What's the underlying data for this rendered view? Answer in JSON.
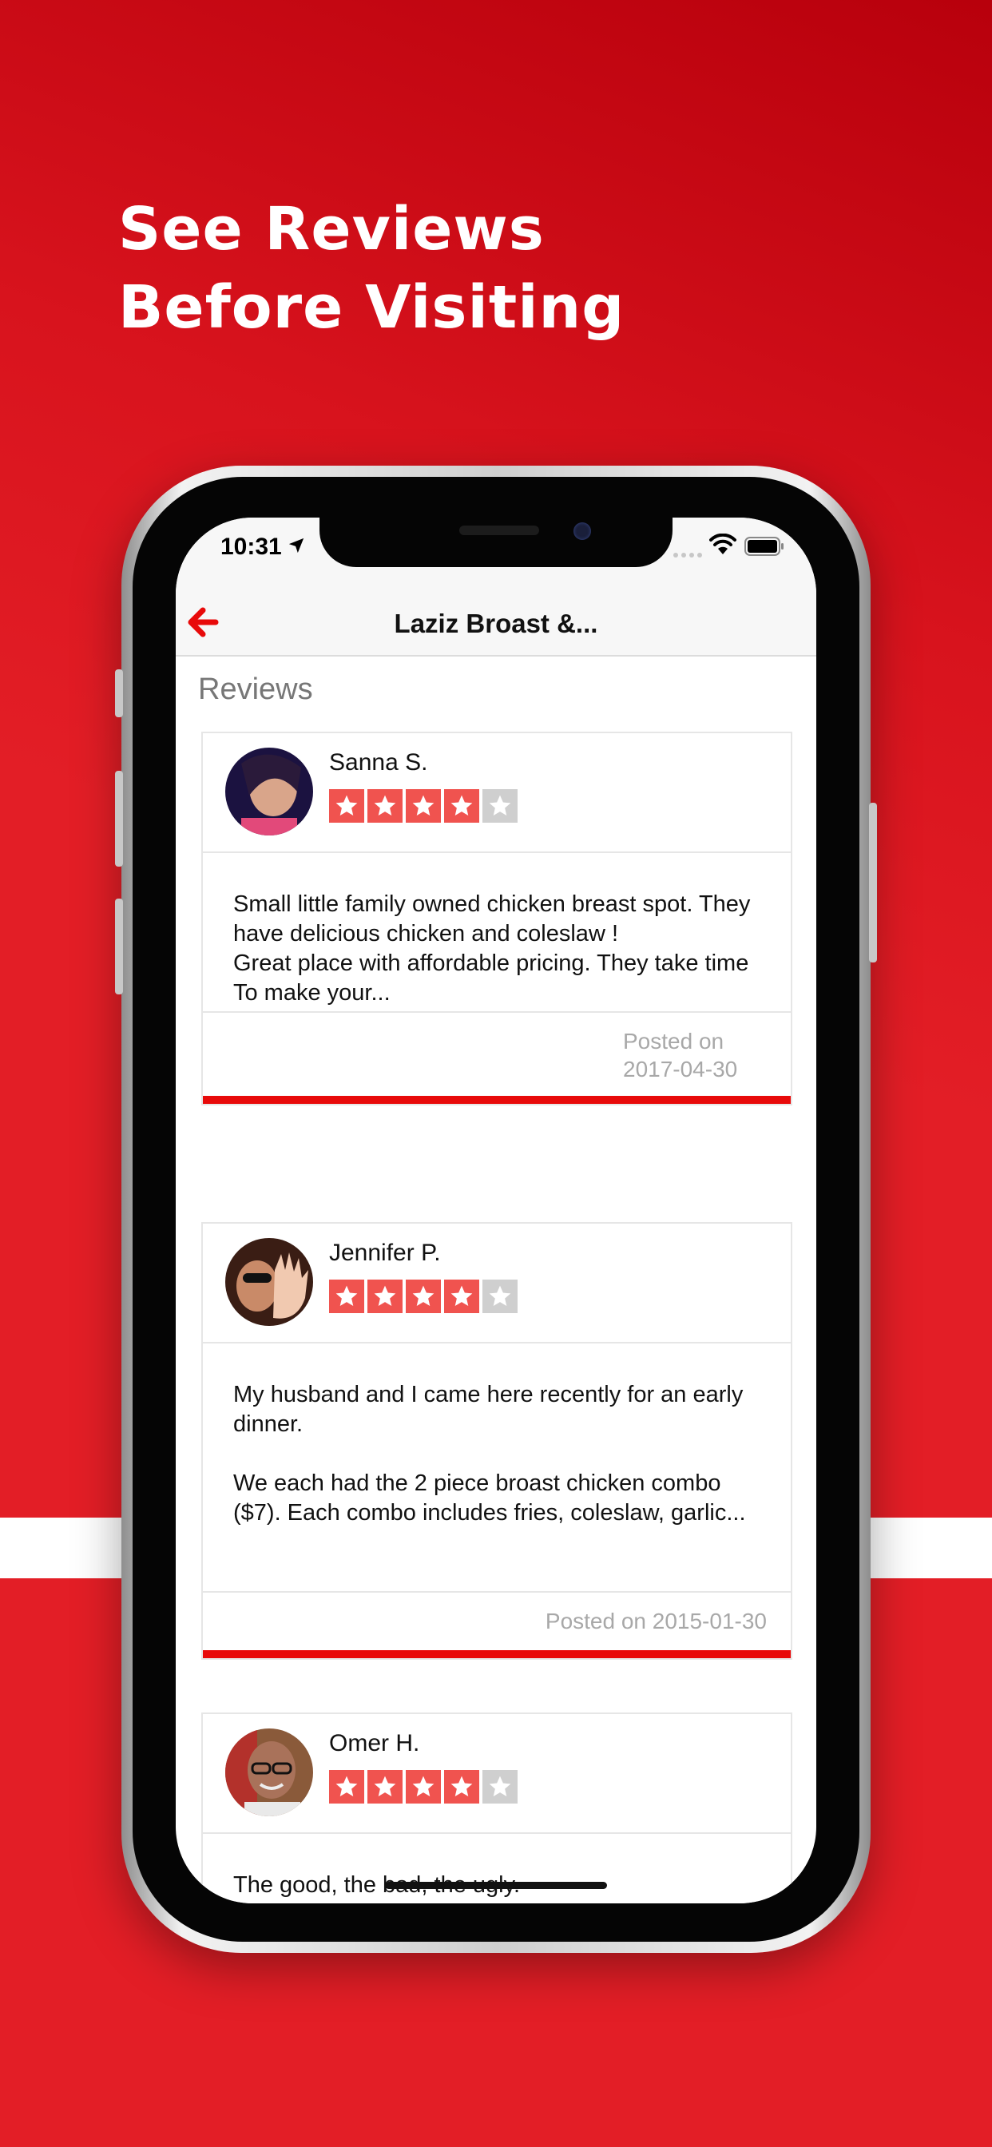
{
  "promo": {
    "headline_line1": "See Reviews",
    "headline_line2": "Before Visiting"
  },
  "status_bar": {
    "time": "10:31"
  },
  "navbar": {
    "title": "Laziz Broast &..."
  },
  "reviews_section": {
    "title": "Reviews",
    "items": [
      {
        "name": "Sanna S.",
        "rating": 4,
        "text": "Small little family owned chicken breast spot. They have delicious chicken and coleslaw !\nGreat place with affordable pricing. They take time\nTo make your...",
        "posted": "Posted on 2017-04-30"
      },
      {
        "name": "Jennifer P.",
        "rating": 4,
        "text": "My husband and I came here recently for an early dinner.\n\nWe each had the 2 piece broast chicken combo ($7).  Each combo includes fries, coleslaw, garlic...",
        "posted": "Posted on 2015-01-30"
      },
      {
        "name": "Omer H.",
        "rating": 4,
        "text": "The good, the bad, the ugly.",
        "posted": ""
      }
    ]
  },
  "colors": {
    "brand_red": "#e31e26",
    "star_on": "#f0534f",
    "star_off": "#cfcfcf",
    "accent_bar": "#e80a0a"
  }
}
